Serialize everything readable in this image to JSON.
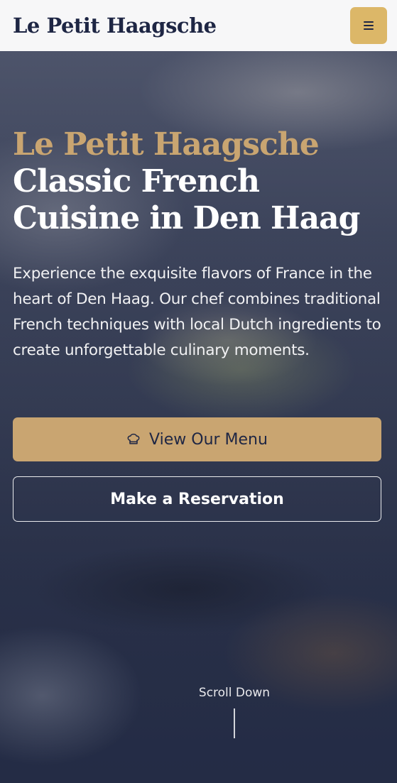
{
  "navbar": {
    "brand": "Le Petit Haagsche",
    "menu_icon": "hamburger-icon",
    "menu_button_color": "#dcb768"
  },
  "hero": {
    "title_accent": "Le Petit Haagsche",
    "title_main": "Classic French Cuisine in Den Haag",
    "description": "Experience the exquisite flavors of France in the heart of Den Haag. Our chef combines traditional French techniques with local Dutch ingredients to create unforgettable culinary moments.",
    "primary_button": {
      "label": "View Our Menu",
      "icon": "chef-hat-icon"
    },
    "secondary_button": {
      "label": "Make a Reservation"
    },
    "scroll_label": "Scroll Down"
  },
  "colors": {
    "accent_gold": "#c9a571",
    "navy": "#1e2644",
    "white": "#ffffff"
  }
}
